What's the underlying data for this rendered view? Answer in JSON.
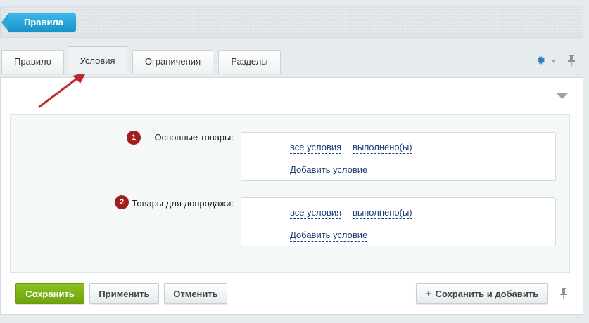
{
  "header": {
    "back_label": "Правила"
  },
  "tabs": [
    {
      "label": "Правило",
      "active": false
    },
    {
      "label": "Условия",
      "active": true
    },
    {
      "label": "Ограничения",
      "active": false
    },
    {
      "label": "Разделы",
      "active": false
    }
  ],
  "toolbar": {
    "settings_icon": "gear-icon",
    "pin_icon": "pin-icon"
  },
  "form": {
    "main_goods": {
      "badge": "1",
      "label": "Основные товары:",
      "all_conditions": "все условия",
      "fulfilled": "выполнено(ы)",
      "add_condition": "Добавить условие"
    },
    "upsell_goods": {
      "badge": "2",
      "label": "Товары для допродажи:",
      "all_conditions": "все условия",
      "fulfilled": "выполнено(ы)",
      "add_condition": "Добавить условие"
    }
  },
  "buttons": {
    "save": "Сохранить",
    "apply": "Применить",
    "cancel": "Отменить",
    "save_and_add": "Сохранить и добавить"
  },
  "colors": {
    "accent_blue": "#2aa6db",
    "save_green": "#7cb518",
    "badge_red": "#a31d1d",
    "annotation_arrow": "#c0282d"
  }
}
